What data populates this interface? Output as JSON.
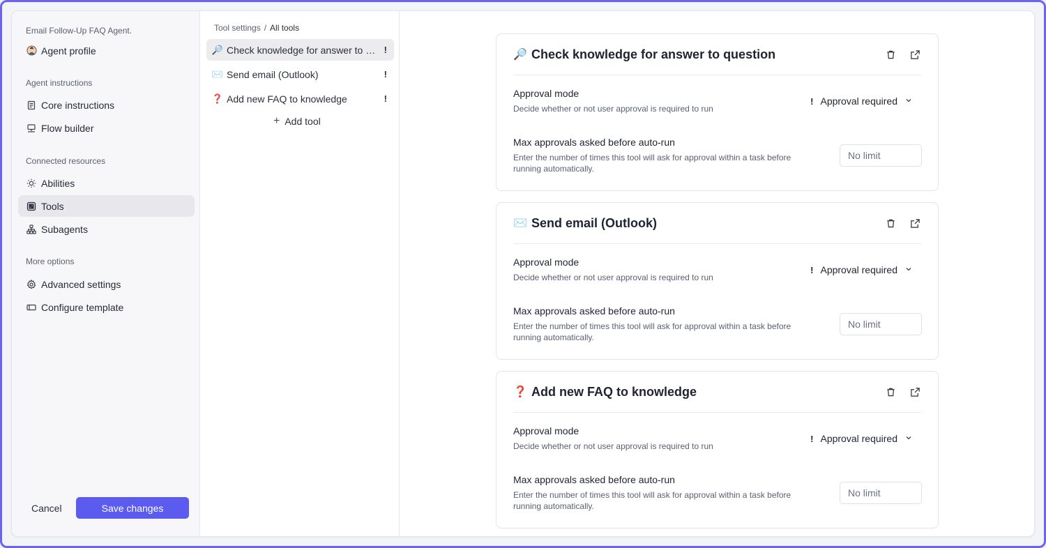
{
  "sidebar": {
    "agent_title": "Email Follow-Up FAQ Agent.",
    "agent_profile": "Agent profile",
    "sections": {
      "instructions": "Agent instructions",
      "resources": "Connected resources",
      "more": "More options"
    },
    "items": {
      "core": "Core instructions",
      "flow": "Flow builder",
      "abilities": "Abilities",
      "tools": "Tools",
      "subagents": "Subagents",
      "advanced": "Advanced settings",
      "template": "Configure template"
    },
    "cancel_label": "Cancel",
    "save_label": "Save changes"
  },
  "tools_column": {
    "breadcrumb": {
      "parent": "Tool settings",
      "separator": "/",
      "current": "All tools"
    },
    "tools": [
      {
        "emoji": "🔎",
        "name": "Check knowledge for answer to question",
        "flag": "!"
      },
      {
        "emoji": "✉️",
        "name": "Send email (Outlook)",
        "flag": "!"
      },
      {
        "emoji": "❓",
        "name": "Add new FAQ to knowledge",
        "flag": "!"
      }
    ],
    "add_tool_label": "Add tool",
    "add_tool_symbol": "+"
  },
  "cards": [
    {
      "emoji": "🔎",
      "title": "Check knowledge for answer to question",
      "approval_label": "Approval mode",
      "approval_desc": "Decide whether or not user approval is required to run",
      "approval_flag": "!",
      "approval_value": "Approval required",
      "max_label": "Max approvals asked before auto-run",
      "max_desc": "Enter the number of times this tool will ask for approval within a task before running automatically.",
      "max_placeholder": "No limit"
    },
    {
      "emoji": "✉️",
      "title": "Send email (Outlook)",
      "approval_label": "Approval mode",
      "approval_desc": "Decide whether or not user approval is required to run",
      "approval_flag": "!",
      "approval_value": "Approval required",
      "max_label": "Max approvals asked before auto-run",
      "max_desc": "Enter the number of times this tool will ask for approval within a task before running automatically.",
      "max_placeholder": "No limit"
    },
    {
      "emoji": "❓",
      "title": "Add new FAQ to knowledge",
      "approval_label": "Approval mode",
      "approval_desc": "Decide whether or not user approval is required to run",
      "approval_flag": "!",
      "approval_value": "Approval required",
      "max_label": "Max approvals asked before auto-run",
      "max_desc": "Enter the number of times this tool will ask for approval within a task before running automatically.",
      "max_placeholder": "No limit"
    }
  ],
  "icons": {
    "agent_avatar": "agent-avatar-icon",
    "core": "document-icon",
    "flow": "flow-icon",
    "abilities": "sun-icon",
    "tools": "tools-grid-icon",
    "subagents": "hierarchy-icon",
    "advanced": "gear-icon",
    "template": "template-icon",
    "delete": "trash-icon",
    "open": "external-link-icon",
    "dropdown": "chevron-down-icon"
  },
  "colors": {
    "accent": "#5b5bf0",
    "frame": "#6b63f2",
    "active_bg": "#e8e8ec"
  }
}
